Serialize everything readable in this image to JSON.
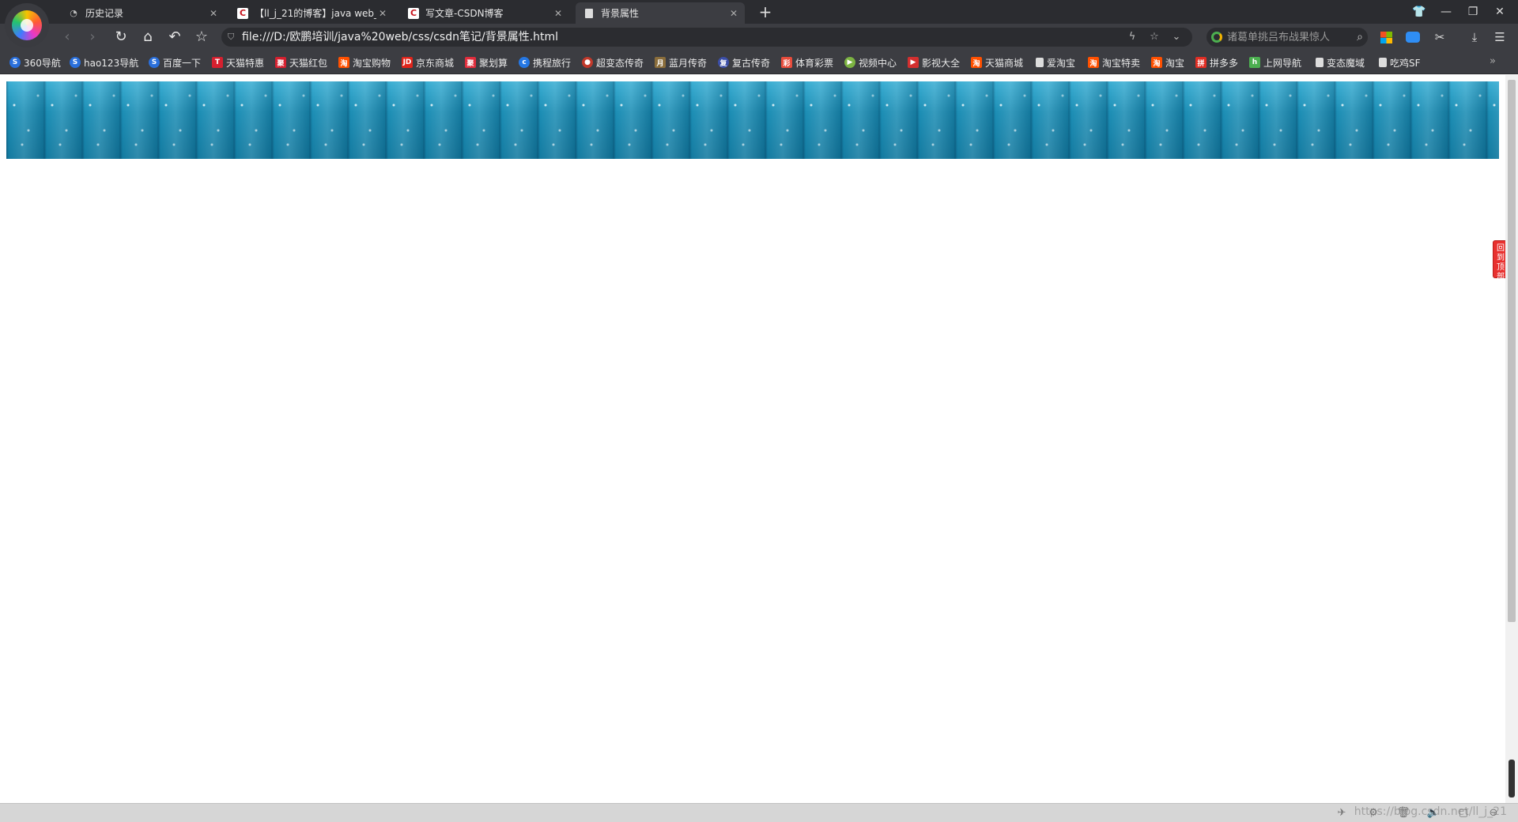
{
  "tabs": [
    {
      "title": "历史记录",
      "icon": "history-icon"
    },
    {
      "title": "【ll_j_21的博客】java web_",
      "icon": "csdn-icon"
    },
    {
      "title": "写文章-CSDN博客",
      "icon": "csdn-icon"
    },
    {
      "title": "背景属性",
      "icon": "document-icon"
    }
  ],
  "address_bar": {
    "url": "file:///D:/欧鹏培训/java%20web/css/csdn笔记/背景属性.html"
  },
  "search": {
    "placeholder": "诸葛单挑吕布战果惊人"
  },
  "csdn_favicon_letter": "C",
  "bookmarks": [
    {
      "label": "360导航",
      "color": "#2a6fdb"
    },
    {
      "label": "hao123导航",
      "color": "#2a6fdb"
    },
    {
      "label": "百度一下",
      "color": "#2a6fdb"
    },
    {
      "label": "天猫特惠",
      "color": "#d5202f"
    },
    {
      "label": "天猫红包",
      "color": "#d5202f"
    },
    {
      "label": "淘宝购物",
      "color": "#ff5000"
    },
    {
      "label": "京东商城",
      "color": "#e1251b"
    },
    {
      "label": "聚划算",
      "color": "#e02d3c"
    },
    {
      "label": "携程旅行",
      "color": "#2577e3"
    },
    {
      "label": "超变态传奇",
      "color": "#c0392b"
    },
    {
      "label": "蓝月传奇",
      "color": "#8a6d3b"
    },
    {
      "label": "复古传奇",
      "color": "#3b4ea8"
    },
    {
      "label": "体育彩票",
      "color": "#e74c3c"
    },
    {
      "label": "视频中心",
      "color": "#7cb342"
    },
    {
      "label": "影视大全",
      "color": "#d32f2f"
    },
    {
      "label": "天猫商城",
      "color": "#ff5000"
    },
    {
      "label": "爱淘宝",
      "color": "#dddddd"
    },
    {
      "label": "淘宝特卖",
      "color": "#ff5000"
    },
    {
      "label": "淘宝",
      "color": "#ff5000"
    },
    {
      "label": "拼多多",
      "color": "#e02e24"
    },
    {
      "label": "上网导航",
      "color": "#4caf50"
    },
    {
      "label": "变态魔域",
      "color": "#dddddd"
    },
    {
      "label": "吃鸡SF",
      "color": "#dddddd"
    }
  ],
  "side_widget": {
    "label": "回到\n顶部"
  },
  "status": {
    "watermark": "https://blog.csdn.net/ll_j_21"
  }
}
